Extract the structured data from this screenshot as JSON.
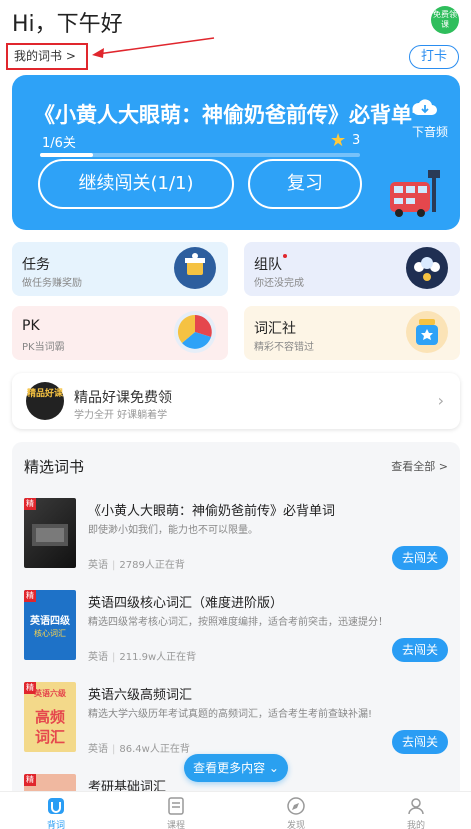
{
  "header": {
    "greeting": "Hi，下午好",
    "free_badge": "免费领课",
    "my_books": "我的词书 >",
    "checkin": "打卡"
  },
  "hero": {
    "title": "《小黄人大眼萌：神偷奶爸前传》必背单词",
    "progress_text": "1/6关",
    "progress_fraction": 0.167,
    "stars": "3",
    "download": "下音频",
    "continue_button": "继续闯关(1/1)",
    "review_button": "复习"
  },
  "cards": [
    {
      "title": "任务",
      "sub": "做任务赚奖励",
      "icon": "task-icon"
    },
    {
      "title": "组队",
      "sub": "你还没完成",
      "icon": "team-icon"
    },
    {
      "title": "PK",
      "sub": "PK当词霸",
      "icon": "pk-icon"
    },
    {
      "title": "词汇社",
      "sub": "精彩不容错过",
      "icon": "club-icon"
    }
  ],
  "promo": {
    "img_text": "精品好课",
    "title": "精品好课免费领",
    "sub": "学力全开 好课躺着学"
  },
  "selected": {
    "title": "精选词书",
    "see_all": "查看全部 >",
    "tag": "精",
    "books": [
      {
        "title": "《小黄人大眼萌：神偷奶爸前传》必背单词",
        "desc": "即使渺小如我们，能力也不可以限量。",
        "lang": "英语",
        "count": "2789人正在背",
        "button": "去闯关"
      },
      {
        "title": "英语四级核心词汇（难度进阶版）",
        "desc": "精选四级常考核心词汇，按照难度编排，适合考前突击，迅速提分！",
        "lang": "英语",
        "count": "211.9w人正在背",
        "button": "去闯关",
        "cover_text1": "英语四级",
        "cover_text2": "核心词汇"
      },
      {
        "title": "英语六级高频词汇",
        "desc": "精选大学六级历年考试真题的高频词汇，适合考生考前查缺补漏!",
        "lang": "英语",
        "count": "86.4w人正在背",
        "button": "去闯关",
        "cover_text1": "英语六级",
        "cover_text2": "高频",
        "cover_text3": "词汇"
      },
      {
        "title": "考研基础词汇"
      }
    ],
    "more_button": "查看更多内容 ⌄"
  },
  "tabbar": [
    {
      "label": "背词",
      "icon": "vocab-icon",
      "active": true
    },
    {
      "label": "课程",
      "icon": "course-icon",
      "active": false
    },
    {
      "label": "发现",
      "icon": "discover-icon",
      "active": false
    },
    {
      "label": "我的",
      "icon": "profile-icon",
      "active": false
    }
  ],
  "colors": {
    "accent": "#2a9df4",
    "hero": "#2ea2f7",
    "highlight": "#e0262d"
  }
}
